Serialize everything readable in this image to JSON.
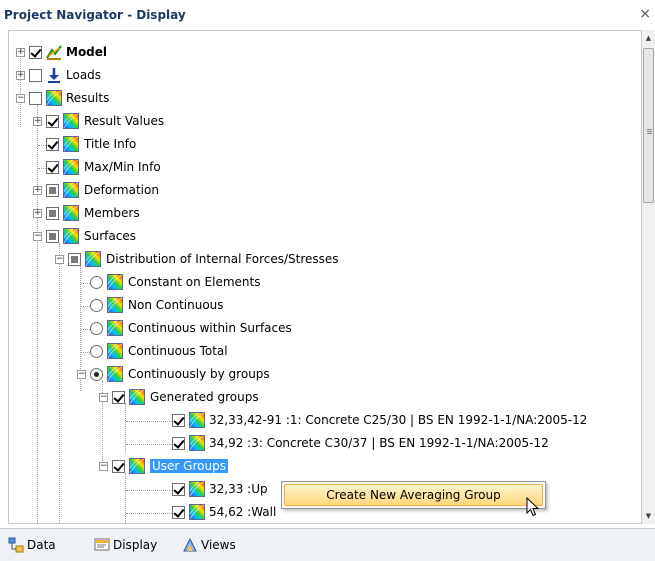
{
  "window": {
    "title": "Project Navigator - Display",
    "close_glyph": "×"
  },
  "tree": {
    "model": "Model",
    "loads": "Loads",
    "results": "Results",
    "result_values": "Result Values",
    "title_info": "Title Info",
    "maxmin_info": "Max/Min Info",
    "deformation": "Deformation",
    "members": "Members",
    "surfaces": "Surfaces",
    "distribution": "Distribution of Internal Forces/Stresses",
    "opt_constant": "Constant on Elements",
    "opt_noncontinuous": "Non Continuous",
    "opt_within": "Continuous within Surfaces",
    "opt_total": "Continuous Total",
    "opt_groups": "Continuously by groups",
    "generated_groups": "Generated groups",
    "gen_1": "32,33,42-91 :1: Concrete C25/30 | BS EN 1992-1-1/NA:2005-12",
    "gen_2": "34,92 :3: Concrete C30/37 | BS EN 1992-1-1/NA:2005-12",
    "user_groups": "User Groups",
    "user_1": "32,33 :Up",
    "user_2": "54,62 :Wall"
  },
  "context_menu": {
    "create": "Create New Averaging Group"
  },
  "tabs": {
    "data": "Data",
    "display": "Display",
    "views": "Views"
  },
  "colors": {
    "selection": "#3399ff",
    "menu_highlight": "#ffd67c",
    "title": "#1e3963"
  }
}
